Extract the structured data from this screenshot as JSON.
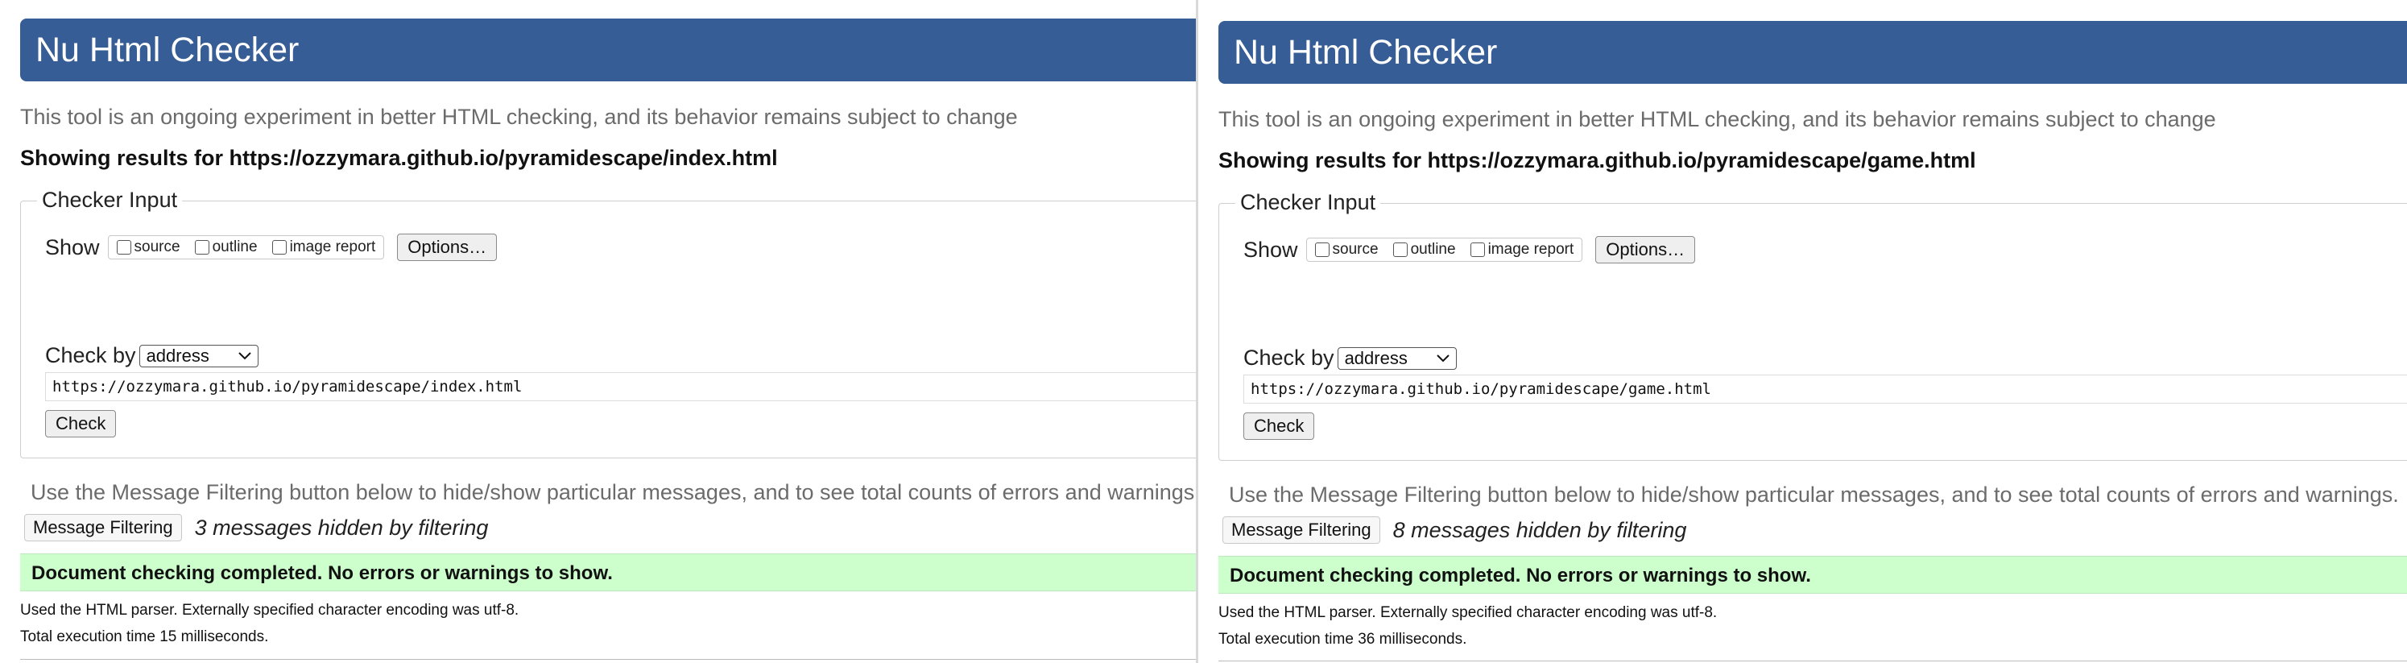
{
  "panels": [
    {
      "title": "Nu Html Checker",
      "intro": "This tool is an ongoing experiment in better HTML checking, and its behavior remains subject to change",
      "results_for": "Showing results for https://ozzymara.github.io/pyramidescape/index.html",
      "fieldset_legend": "Checker Input",
      "show_label": "Show",
      "show_options": [
        "source",
        "outline",
        "image report"
      ],
      "options_button": "Options…",
      "check_by_label": "Check by",
      "check_by_value": "address",
      "url_value": "https://ozzymara.github.io/pyramidescape/index.html",
      "check_button": "Check",
      "filter_note": "Use the Message Filtering button below to hide/show particular messages, and to see total counts of errors and warnings.",
      "filter_button": "Message Filtering",
      "hidden_messages": "3 messages hidden by filtering",
      "success": "Document checking completed. No errors or warnings to show.",
      "parser_note": "Used the HTML parser. Externally specified character encoding was utf-8.",
      "exec_time": "Total execution time 15 milliseconds."
    },
    {
      "title": "Nu Html Checker",
      "intro": "This tool is an ongoing experiment in better HTML checking, and its behavior remains subject to change",
      "results_for": "Showing results for https://ozzymara.github.io/pyramidescape/game.html",
      "fieldset_legend": "Checker Input",
      "show_label": "Show",
      "show_options": [
        "source",
        "outline",
        "image report"
      ],
      "options_button": "Options…",
      "check_by_label": "Check by",
      "check_by_value": "address",
      "url_value": "https://ozzymara.github.io/pyramidescape/game.html",
      "check_button": "Check",
      "filter_note": "Use the Message Filtering button below to hide/show particular messages, and to see total counts of errors and warnings.",
      "filter_button": "Message Filtering",
      "hidden_messages": "8 messages hidden by filtering",
      "success": "Document checking completed. No errors or warnings to show.",
      "parser_note": "Used the HTML parser. Externally specified character encoding was utf-8.",
      "exec_time": "Total execution time 36 milliseconds."
    }
  ],
  "colors": {
    "banner": "#365d95",
    "success_bg": "#ccffcc",
    "muted_text": "#6b6b6b"
  }
}
